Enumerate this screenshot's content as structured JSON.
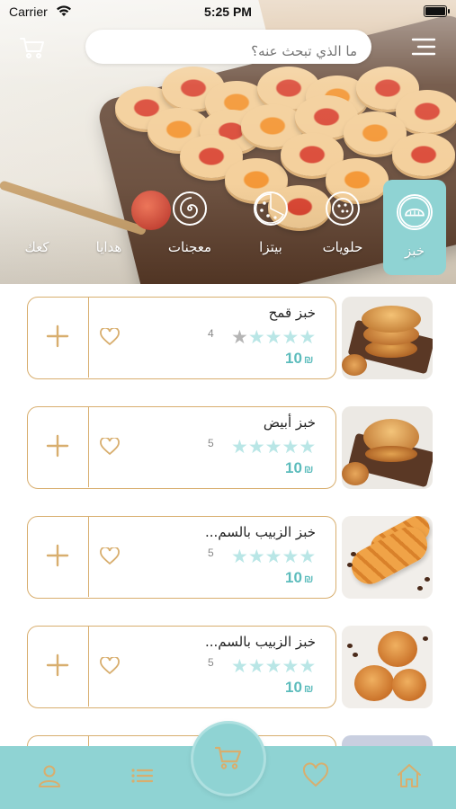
{
  "status_bar": {
    "carrier": "Carrier",
    "time": "5:25 PM"
  },
  "header": {
    "search_placeholder": "ما الذي تبحث عنه؟"
  },
  "categories": [
    {
      "label": "خبز",
      "icon": "bread-icon",
      "active": true
    },
    {
      "label": "حلويات",
      "icon": "cookie-icon",
      "active": false
    },
    {
      "label": "بيتزا",
      "icon": "pizza-icon",
      "active": false
    },
    {
      "label": "معجنات",
      "icon": "pastry-swirl-icon",
      "active": false
    },
    {
      "label": "هدايا",
      "icon": "",
      "active": false
    },
    {
      "label": "كعك",
      "icon": "",
      "active": false
    }
  ],
  "products": [
    {
      "name": "خبز قمح",
      "rating": "4",
      "stars": 4,
      "price": "10",
      "currency": "₪"
    },
    {
      "name": "خبز أبيض",
      "rating": "5",
      "stars": 5,
      "price": "10",
      "currency": "₪"
    },
    {
      "name": "خبز الزبيب بالسم...",
      "rating": "5",
      "stars": 5,
      "price": "10",
      "currency": "₪"
    },
    {
      "name": "خبز الزبيب بالسم...",
      "rating": "5",
      "stars": 5,
      "price": "10",
      "currency": "₪"
    }
  ],
  "colors": {
    "accent": "#8fd3d3",
    "gold": "#d8ae6e",
    "price": "#5cbcbc"
  },
  "nav": {
    "items": [
      "profile-icon",
      "list-icon",
      "cart-icon",
      "heart-icon",
      "home-icon"
    ]
  }
}
